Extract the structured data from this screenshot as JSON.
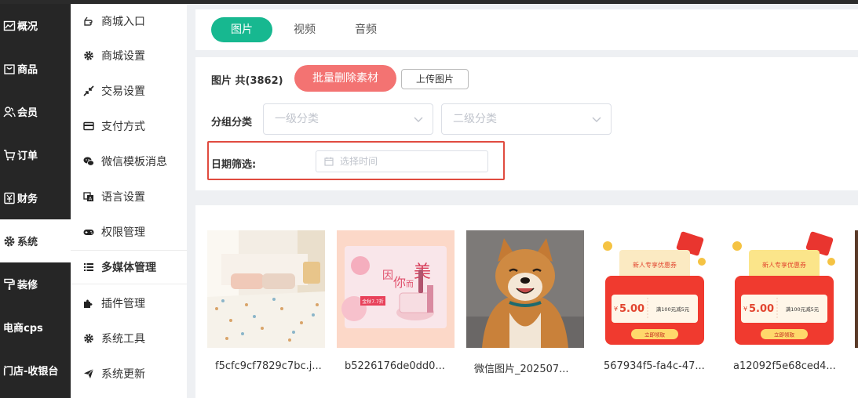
{
  "nav": {
    "items": [
      {
        "label": "概况",
        "icon": "chart-line-icon"
      },
      {
        "label": "商品",
        "icon": "bag-icon"
      },
      {
        "label": "会员",
        "icon": "users-icon"
      },
      {
        "label": "订单",
        "icon": "cart-icon"
      },
      {
        "label": "财务",
        "icon": "finance-icon"
      },
      {
        "label": "系统",
        "icon": "gear-icon",
        "active": true
      },
      {
        "label": "装修",
        "icon": "paint-roller-icon"
      },
      {
        "label": "电商cps",
        "icon": ""
      },
      {
        "label": "门店-收银台",
        "icon": ""
      }
    ]
  },
  "subnav": {
    "items": [
      {
        "label": "商城入口",
        "icon": "hand-point-icon"
      },
      {
        "label": "商城设置",
        "icon": "gear-icon"
      },
      {
        "label": "交易设置",
        "icon": "arrows-in-icon"
      },
      {
        "label": "支付方式",
        "icon": "credit-card-icon"
      },
      {
        "label": "微信模板消息",
        "icon": "wechat-icon"
      },
      {
        "label": "语言设置",
        "icon": "language-icon"
      },
      {
        "label": "权限管理",
        "icon": "gamepad-icon"
      },
      {
        "label": "多媒体管理",
        "icon": "list-icon",
        "active": true
      },
      {
        "label": "插件管理",
        "icon": "puzzle-icon"
      },
      {
        "label": "系统工具",
        "icon": "gear-icon"
      },
      {
        "label": "系统更新",
        "icon": "paper-plane-icon"
      }
    ]
  },
  "tabs": [
    {
      "label": "图片",
      "active": true
    },
    {
      "label": "视频"
    },
    {
      "label": "音频"
    }
  ],
  "toolbar": {
    "count_label": "图片 共(3862)",
    "delete_button": "批量删除素材",
    "upload_button": "上传图片"
  },
  "filters": {
    "group_label": "分组分类",
    "level1_placeholder": "一级分类",
    "level2_placeholder": "二级分类",
    "date_label": "日期筛选:",
    "date_placeholder": "选择时间"
  },
  "images": [
    {
      "caption": "f5cfc9cf7829c7bc.j...",
      "thumb": "bedding"
    },
    {
      "caption": "b5226176de0dd0...",
      "thumb": "cosmetics",
      "thumb_text": [
        "因",
        "你",
        "而",
        "美"
      ],
      "badge": "金秋7.7折"
    },
    {
      "caption": "微信图片_202507...",
      "thumb": "dog"
    },
    {
      "caption": "567934f5-fa4c-47...",
      "thumb": "coupon",
      "coupon": {
        "title": "新人专享优惠券",
        "amount": "5.00",
        "condition": "满100元减5元",
        "button": "立即领取"
      }
    },
    {
      "caption": "a12092f5e68ced4...",
      "thumb": "coupon",
      "coupon": {
        "title": "新人专享优惠券",
        "amount": "5.00",
        "condition": "满100元减5元",
        "button": "立即领取"
      }
    }
  ],
  "colors": {
    "accent": "#17b890",
    "danger": "#f37372",
    "highlight_border": "#e04b3f",
    "nav_bg": "#262626"
  }
}
